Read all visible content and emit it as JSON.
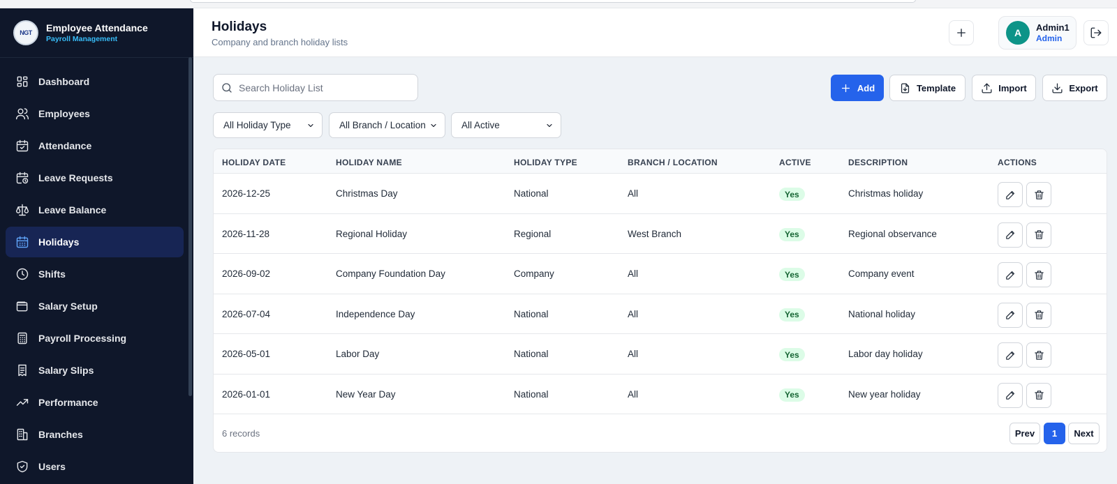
{
  "brand": {
    "logo_text": "NGT",
    "title": "Employee Attendance",
    "subtitle": "Payroll Management"
  },
  "nav": [
    {
      "label": "Dashboard",
      "icon": "dashboard-icon"
    },
    {
      "label": "Employees",
      "icon": "users-icon"
    },
    {
      "label": "Attendance",
      "icon": "calendar-check-icon"
    },
    {
      "label": "Leave Requests",
      "icon": "calendar-clock-icon"
    },
    {
      "label": "Leave Balance",
      "icon": "scale-icon"
    },
    {
      "label": "Holidays",
      "icon": "calendar-grid-icon",
      "active": true
    },
    {
      "label": "Shifts",
      "icon": "clock-icon"
    },
    {
      "label": "Salary Setup",
      "icon": "wallet-icon"
    },
    {
      "label": "Payroll Processing",
      "icon": "calculator-icon"
    },
    {
      "label": "Salary Slips",
      "icon": "receipt-icon"
    },
    {
      "label": "Performance",
      "icon": "trending-up-icon"
    },
    {
      "label": "Branches",
      "icon": "building-icon"
    },
    {
      "label": "Users",
      "icon": "shield-icon"
    }
  ],
  "header": {
    "title": "Holidays",
    "subtitle": "Company and branch holiday lists",
    "user": {
      "initial": "A",
      "name": "Admin1",
      "role": "Admin"
    }
  },
  "toolbar": {
    "search_placeholder": "Search Holiday List",
    "add_label": "Add",
    "template_label": "Template",
    "import_label": "Import",
    "export_label": "Export"
  },
  "filters": {
    "holiday_type": "All Holiday Type",
    "branch": "All Branch / Location",
    "active": "All Active"
  },
  "table": {
    "columns": [
      "HOLIDAY DATE",
      "HOLIDAY NAME",
      "HOLIDAY TYPE",
      "BRANCH / LOCATION",
      "ACTIVE",
      "DESCRIPTION",
      "ACTIONS"
    ],
    "rows": [
      {
        "date": "2026-12-25",
        "name": "Christmas Day",
        "type": "National",
        "branch": "All",
        "active": "Yes",
        "description": "Christmas holiday"
      },
      {
        "date": "2026-11-28",
        "name": "Regional Holiday",
        "type": "Regional",
        "branch": "West Branch",
        "active": "Yes",
        "description": "Regional observance"
      },
      {
        "date": "2026-09-02",
        "name": "Company Foundation Day",
        "type": "Company",
        "branch": "All",
        "active": "Yes",
        "description": "Company event"
      },
      {
        "date": "2026-07-04",
        "name": "Independence Day",
        "type": "National",
        "branch": "All",
        "active": "Yes",
        "description": "National holiday"
      },
      {
        "date": "2026-05-01",
        "name": "Labor Day",
        "type": "National",
        "branch": "All",
        "active": "Yes",
        "description": "Labor day holiday"
      },
      {
        "date": "2026-01-01",
        "name": "New Year Day",
        "type": "National",
        "branch": "All",
        "active": "Yes",
        "description": "New year holiday"
      }
    ],
    "records_text": "6 records"
  },
  "pagination": {
    "prev": "Prev",
    "current": "1",
    "next": "Next"
  },
  "colors": {
    "sidebar": "#0f172a",
    "accent": "#2563eb",
    "active_badge_bg": "#dcfce7",
    "active_badge_text": "#166534",
    "avatar": "#0d9488"
  }
}
